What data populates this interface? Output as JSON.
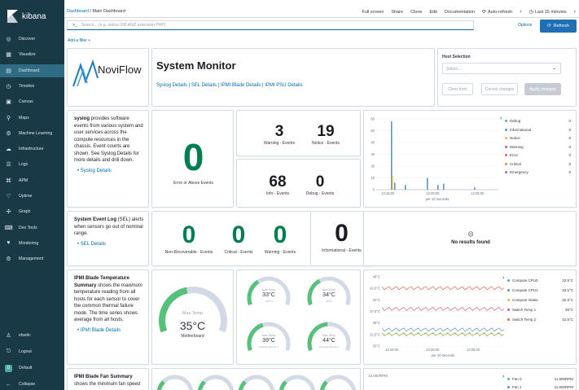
{
  "brand": {
    "name": "kibana"
  },
  "sidebar": {
    "items": [
      {
        "label": "Discover",
        "icon": "compass-icon"
      },
      {
        "label": "Visualize",
        "icon": "visualize-icon"
      },
      {
        "label": "Dashboard",
        "icon": "dashboard-icon",
        "active": true
      },
      {
        "label": "Timelion",
        "icon": "timelion-icon"
      },
      {
        "label": "Canvas",
        "icon": "canvas-icon"
      },
      {
        "label": "Maps",
        "icon": "maps-icon"
      },
      {
        "label": "Machine Learning",
        "icon": "ml-icon"
      },
      {
        "label": "Infrastructure",
        "icon": "infrastructure-icon"
      },
      {
        "label": "Logs",
        "icon": "logs-icon"
      },
      {
        "label": "APM",
        "icon": "apm-icon"
      },
      {
        "label": "Uptime",
        "icon": "uptime-icon"
      },
      {
        "label": "Graph",
        "icon": "graph-icon"
      },
      {
        "label": "Dev Tools",
        "icon": "devtools-icon"
      },
      {
        "label": "Monitoring",
        "icon": "monitoring-icon"
      },
      {
        "label": "Management",
        "icon": "gear-icon"
      }
    ],
    "bottom": [
      {
        "label": "elastic",
        "icon": "user-icon"
      },
      {
        "label": "Logout",
        "icon": "logout-icon"
      },
      {
        "label": "Default",
        "badge": "D"
      },
      {
        "label": "Collapse",
        "icon": "collapse-icon"
      }
    ]
  },
  "topbar": {
    "crumb_root": "Dashboard",
    "crumb_sep": "/",
    "crumb_current": "Main Dashboard",
    "links": [
      "Full screen",
      "Share",
      "Clone",
      "Edit",
      "Documentation"
    ],
    "auto_refresh": "Auto-refresh",
    "time_range": "Last 15 minutes"
  },
  "query": {
    "prompt": ">_",
    "placeholder": "Search... (e.g. status:200 AND extension:PHP)",
    "options": "Options",
    "refresh": "Refresh"
  },
  "add_filter": "Add a filter +",
  "header": {
    "logo_text": "NoviFlow",
    "title": "System Monitor",
    "links": [
      "Syslog Details",
      "SEL Details",
      "IPMI Blade Details",
      "IPMI PSU Details"
    ],
    "separator": " | "
  },
  "host": {
    "label": "Host Selection",
    "placeholder": "Select...",
    "clear": "Clear form",
    "cancel": "Cancel changes",
    "apply": "Apply changes"
  },
  "syslog": {
    "title": "syslog",
    "text": " provides software events from various system and user services across the compute resources in the chassis. Event counts are shown. See Syslog Details for more details and drill down.",
    "link": "Syslog Details",
    "error_value": "0",
    "error_label": "Error or Above Events",
    "warning_value": "3",
    "warning_label": "Warning - Events",
    "notice_value": "19",
    "notice_label": "Notice - Events",
    "info_value": "68",
    "info_label": "Info - Events",
    "debug_value": "0",
    "debug_label": "Debug - Events"
  },
  "syslog_chart": {
    "y_ticks": [
      "60",
      "50",
      "40",
      "30",
      "20",
      "10",
      "0"
    ],
    "x_ticks": [
      "13:15:00",
      "13:20:00",
      "13:25:00"
    ],
    "x_label": "per 10 seconds",
    "legend": [
      {
        "name": "Debug",
        "value": "0",
        "color": "#54b399"
      },
      {
        "name": "Informational",
        "value": "0",
        "color": "#6092c0"
      },
      {
        "name": "Notice",
        "value": "0",
        "color": "#d6bf57"
      },
      {
        "name": "Warning",
        "value": "0",
        "color": "#d36086"
      },
      {
        "name": "Error",
        "value": "0",
        "color": "#e7664c"
      },
      {
        "name": "Critical",
        "value": "0",
        "color": "#da8b45"
      },
      {
        "name": "Emergency",
        "value": "0",
        "color": "#9170b8"
      }
    ]
  },
  "sel": {
    "title": "System Event Log",
    "text": " (SEL) alerts when sensors go out of nominal range.",
    "link": "SEL Details",
    "nonrec_value": "0",
    "nonrec_label": "Non-Recoverable - Events",
    "critical_value": "0",
    "critical_label": "Critical - Events",
    "warning_value": "0",
    "warning_label": "Warning - Events",
    "info_value": "0",
    "info_label": "Informational - Events",
    "no_results": "No results found"
  },
  "blade": {
    "title": "IPMI Blade Temperature Summary",
    "text_a": " shows the ",
    "text_em": "maximum",
    "text_b": " temperature reading from all hosts for each sensor to cover the common thermal failure mode. The time series shows average from all hosts.",
    "link": "IPMI Blade Details",
    "gauge_label": "Max Temp",
    "gauge_value": "35°C",
    "gauge_sub": "Motherboard",
    "gauge_fraction": 0.45,
    "small": [
      {
        "label": "Max Temp",
        "value": "33°C",
        "sub": "CPU 0",
        "fraction": 0.35
      },
      {
        "label": "Max Temp",
        "value": "34°C",
        "sub": "CPU 1",
        "fraction": 0.37
      },
      {
        "label": "Max Temp",
        "value": "39°C",
        "sub": "Network Sensor 1",
        "fraction": 0.42
      },
      {
        "label": "Max Temp",
        "value": "44°C",
        "sub": "Network Sensor 2",
        "fraction": 0.48
      }
    ]
  },
  "blade_chart": {
    "y_ticks": [
      "45°C",
      "42.5°C",
      "40°C",
      "37.5°C",
      "35°C",
      "32.5°C",
      "30°C"
    ],
    "x_ticks": [
      "13:15:00",
      "13:20:00",
      "13:25:00"
    ],
    "x_label": "per 10 seconds",
    "legend": [
      {
        "name": "Compute CPU0",
        "value": "32.5°C",
        "color": "#54b399"
      },
      {
        "name": "Compute CPU1",
        "value": "33.5°C",
        "color": "#6092c0"
      },
      {
        "name": "Compute Intake",
        "value": "32.5°C",
        "color": "#d6bf57"
      },
      {
        "name": "Switch Temp 1",
        "value": "38°C",
        "color": "#d36086"
      },
      {
        "name": "Switch Temp 2",
        "value": "42.5°C",
        "color": "#e7664c"
      }
    ]
  },
  "fan": {
    "title": "IPMI Blade Fan Summary",
    "text": " shows the minimum fan speed",
    "chart_y_top": "13,000RPM",
    "legend": [
      {
        "name": "Fan 0",
        "value": "11,600RPM",
        "color": "#54b399"
      },
      {
        "name": "Fan 1",
        "value": "11,600RPM",
        "color": "#6092c0"
      }
    ]
  }
}
